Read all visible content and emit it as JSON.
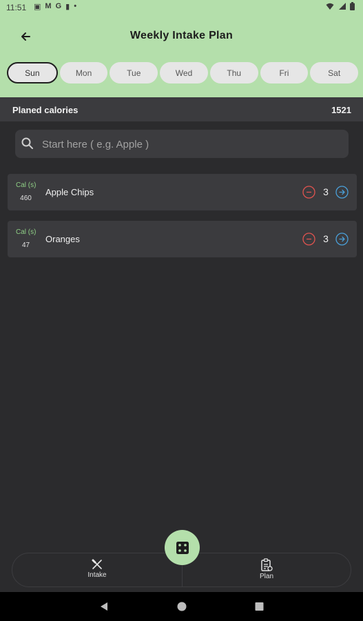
{
  "status_bar": {
    "time": "11:51",
    "notification_icons": [
      "image-icon",
      "mail-icon",
      "google-icon",
      "sim-icon",
      "dot-icon"
    ],
    "system_icons": [
      "wifi-icon",
      "signal-icon",
      "battery-icon"
    ]
  },
  "header": {
    "title": "Weekly Intake Plan",
    "back_icon": "arrow-left-icon",
    "background": "#b4dfab"
  },
  "days": [
    {
      "label": "Sun",
      "active": true
    },
    {
      "label": "Mon",
      "active": false
    },
    {
      "label": "Tue",
      "active": false
    },
    {
      "label": "Wed",
      "active": false
    },
    {
      "label": "Thu",
      "active": false
    },
    {
      "label": "Fri",
      "active": false
    },
    {
      "label": "Sat",
      "active": false
    }
  ],
  "planned": {
    "label": "Planed calories",
    "value": "1521"
  },
  "search": {
    "placeholder": "Start here ( e.g. Apple )",
    "value": ""
  },
  "items": [
    {
      "cal_label": "Cal (s)",
      "cal_value": "460",
      "name": "Apple Chips",
      "quantity": "3"
    },
    {
      "cal_label": "Cal (s)",
      "cal_value": "47",
      "name": "Oranges",
      "quantity": "3"
    }
  ],
  "bottom_nav": {
    "intake_label": "Intake",
    "plan_label": "Plan",
    "fab_icon": "dice-icon"
  },
  "colors": {
    "accent": "#b4dfab",
    "minus": "#e0534f",
    "plus": "#4a9fd8",
    "cal_label": "#8fcf86",
    "background": "#2b2b2d"
  }
}
